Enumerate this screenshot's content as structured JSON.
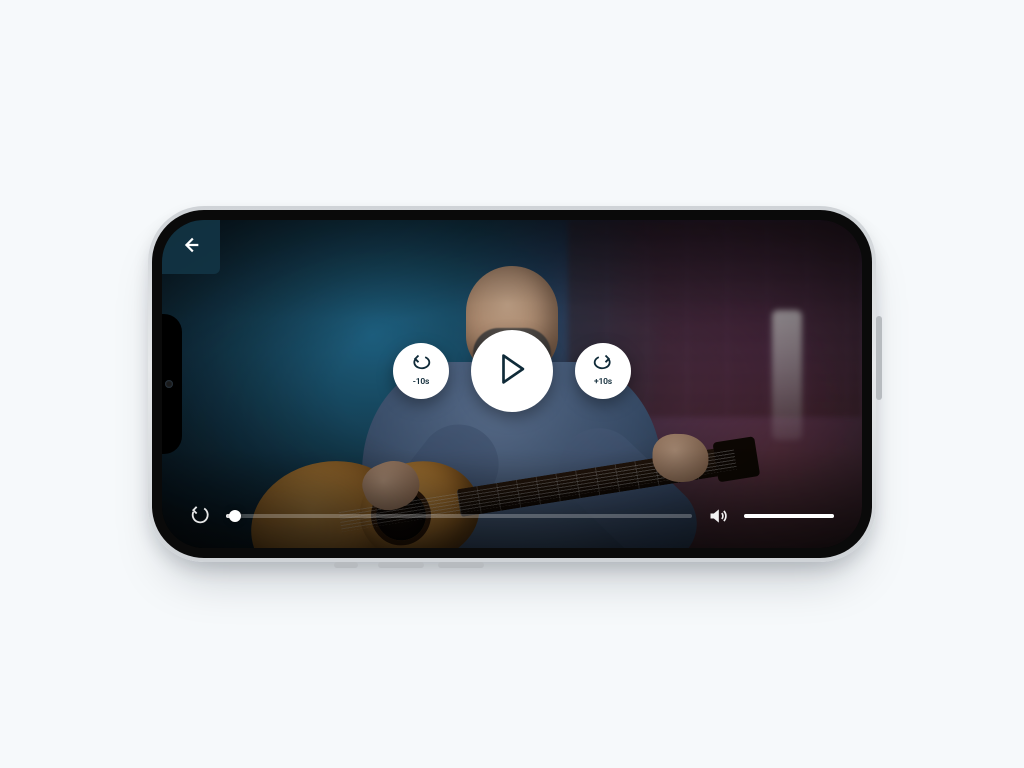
{
  "player": {
    "back_icon": "arrow-left",
    "skip_back_label": "-10s",
    "skip_fwd_label": "+10s",
    "skip_seconds": 10,
    "state": "paused",
    "progress_percent": 2,
    "volume_percent": 100
  },
  "colors": {
    "accent": "#123444",
    "control_bg": "#ffffff",
    "control_fg": "#0f2a38"
  }
}
